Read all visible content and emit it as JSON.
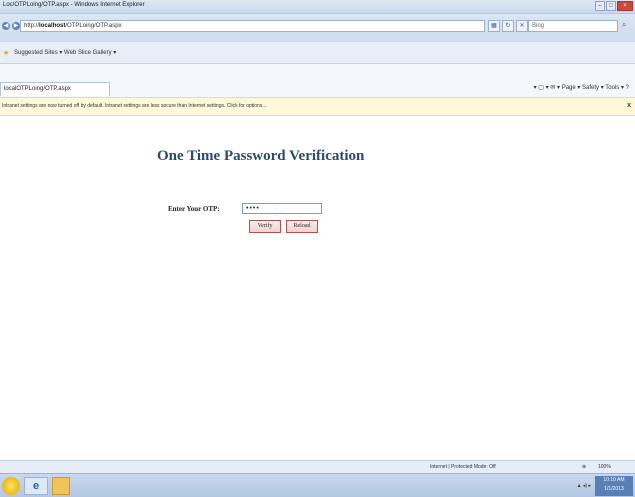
{
  "window": {
    "title": "Loc/OTPLoing/OTP.aspx - Windows Internet Explorer",
    "controls": [
      "–",
      "□",
      "×"
    ]
  },
  "address_bar": {
    "url_prefix": "http://",
    "url_host": "localhost",
    "url_path": "/OTPLoing/OTP.aspx",
    "search_placeholder": "Bing",
    "nav_back_icon": "back-arrow-icon",
    "nav_forward_icon": "forward-arrow-icon"
  },
  "favorites_bar": {
    "items_text": "Suggested Sites ▾   Web Slice Gallery ▾"
  },
  "tab": {
    "label": "localOTPLoing/OTP.aspx"
  },
  "command_bar": {
    "tools_text": "▾ ▢ ▾ ✉ ▾ Page ▾  Safety ▾  Tools ▾ ?"
  },
  "info_bar": {
    "message": "Intranet settings are now turned off by default. Intranet settings are less secure than Internet settings. Click for options...",
    "close": "x"
  },
  "page": {
    "title": "One Time Password Verification",
    "otp_label": "Enter Your OTP:",
    "otp_value": "••••",
    "verify_label": "Verify",
    "reload_label": "Reload"
  },
  "status_bar": {
    "zone": "Internet | Protected Mode: Off",
    "zoom": "100%"
  },
  "taskbar": {
    "tray_text": "▲ ◂) ▸",
    "time": "10:10 AM",
    "date": "1/1/2013"
  },
  "colors": {
    "title_color": "#2c4a6e",
    "button_border": "#b05050",
    "info_bar_bg": "#fdf8d8"
  }
}
